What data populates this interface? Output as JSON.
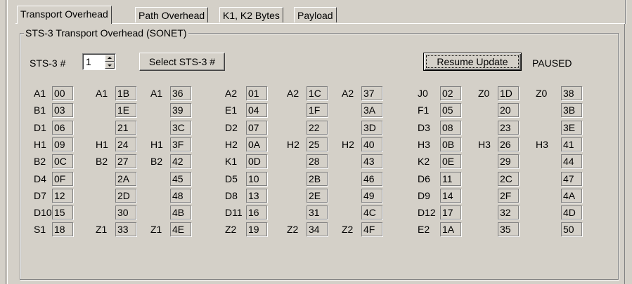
{
  "tabs": [
    "Transport Overhead",
    "Path Overhead",
    "K1, K2 Bytes",
    "Payload"
  ],
  "active_tab": 0,
  "group_title": "STS-3 Transport Overhead (SONET)",
  "sts_label": "STS-3 #",
  "sts_value": "1",
  "select_button": "Select STS-3 #",
  "resume_button": "Resume Update",
  "status": "PAUSED",
  "rows": [
    {
      "cells": [
        {
          "label": "A1",
          "value": "00"
        },
        {
          "label": "A1",
          "value": "1B"
        },
        {
          "label": "A1",
          "value": "36"
        },
        {
          "label": "A2",
          "value": "01"
        },
        {
          "label": "A2",
          "value": "1C"
        },
        {
          "label": "A2",
          "value": "37"
        },
        {
          "label": "J0",
          "value": "02"
        },
        {
          "label": "Z0",
          "value": "1D"
        },
        {
          "label": "Z0",
          "value": "38"
        }
      ]
    },
    {
      "cells": [
        {
          "label": "B1",
          "value": "03"
        },
        {
          "label": "",
          "value": "1E"
        },
        {
          "label": "",
          "value": "39"
        },
        {
          "label": "E1",
          "value": "04"
        },
        {
          "label": "",
          "value": "1F"
        },
        {
          "label": "",
          "value": "3A"
        },
        {
          "label": "F1",
          "value": "05"
        },
        {
          "label": "",
          "value": "20"
        },
        {
          "label": "",
          "value": "3B"
        }
      ]
    },
    {
      "cells": [
        {
          "label": "D1",
          "value": "06"
        },
        {
          "label": "",
          "value": "21"
        },
        {
          "label": "",
          "value": "3C"
        },
        {
          "label": "D2",
          "value": "07"
        },
        {
          "label": "",
          "value": "22"
        },
        {
          "label": "",
          "value": "3D"
        },
        {
          "label": "D3",
          "value": "08"
        },
        {
          "label": "",
          "value": "23"
        },
        {
          "label": "",
          "value": "3E"
        }
      ]
    },
    {
      "cells": [
        {
          "label": "H1",
          "value": "09"
        },
        {
          "label": "H1",
          "value": "24"
        },
        {
          "label": "H1",
          "value": "3F"
        },
        {
          "label": "H2",
          "value": "0A"
        },
        {
          "label": "H2",
          "value": "25"
        },
        {
          "label": "H2",
          "value": "40"
        },
        {
          "label": "H3",
          "value": "0B"
        },
        {
          "label": "H3",
          "value": "26"
        },
        {
          "label": "H3",
          "value": "41"
        }
      ]
    },
    {
      "cells": [
        {
          "label": "B2",
          "value": "0C"
        },
        {
          "label": "B2",
          "value": "27"
        },
        {
          "label": "B2",
          "value": "42"
        },
        {
          "label": "K1",
          "value": "0D"
        },
        {
          "label": "",
          "value": "28"
        },
        {
          "label": "",
          "value": "43"
        },
        {
          "label": "K2",
          "value": "0E"
        },
        {
          "label": "",
          "value": "29"
        },
        {
          "label": "",
          "value": "44"
        }
      ]
    },
    {
      "cells": [
        {
          "label": "D4",
          "value": "0F"
        },
        {
          "label": "",
          "value": "2A"
        },
        {
          "label": "",
          "value": "45"
        },
        {
          "label": "D5",
          "value": "10"
        },
        {
          "label": "",
          "value": "2B"
        },
        {
          "label": "",
          "value": "46"
        },
        {
          "label": "D6",
          "value": "11"
        },
        {
          "label": "",
          "value": "2C"
        },
        {
          "label": "",
          "value": "47"
        }
      ]
    },
    {
      "cells": [
        {
          "label": "D7",
          "value": "12"
        },
        {
          "label": "",
          "value": "2D"
        },
        {
          "label": "",
          "value": "48"
        },
        {
          "label": "D8",
          "value": "13"
        },
        {
          "label": "",
          "value": "2E"
        },
        {
          "label": "",
          "value": "49"
        },
        {
          "label": "D9",
          "value": "14"
        },
        {
          "label": "",
          "value": "2F"
        },
        {
          "label": "",
          "value": "4A"
        }
      ]
    },
    {
      "cells": [
        {
          "label": "D10",
          "value": "15"
        },
        {
          "label": "",
          "value": "30"
        },
        {
          "label": "",
          "value": "4B"
        },
        {
          "label": "D11",
          "value": "16"
        },
        {
          "label": "",
          "value": "31"
        },
        {
          "label": "",
          "value": "4C"
        },
        {
          "label": "D12",
          "value": "17"
        },
        {
          "label": "",
          "value": "32"
        },
        {
          "label": "",
          "value": "4D"
        }
      ]
    },
    {
      "cells": [
        {
          "label": "S1",
          "value": "18"
        },
        {
          "label": "Z1",
          "value": "33"
        },
        {
          "label": "Z1",
          "value": "4E"
        },
        {
          "label": "Z2",
          "value": "19"
        },
        {
          "label": "Z2",
          "value": "34"
        },
        {
          "label": "Z2",
          "value": "4F"
        },
        {
          "label": "E2",
          "value": "1A"
        },
        {
          "label": "",
          "value": "35"
        },
        {
          "label": "",
          "value": "50"
        }
      ]
    }
  ]
}
